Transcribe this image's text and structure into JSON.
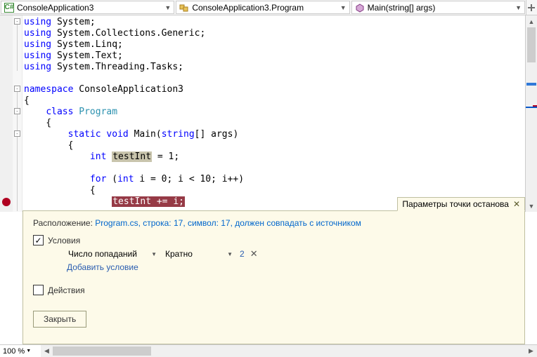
{
  "nav": {
    "project": "ConsoleApplication3",
    "class": "ConsoleApplication3.Program",
    "method": "Main(string[] args)"
  },
  "code": {
    "lines": [
      {
        "indent": "",
        "tokens": [
          {
            "t": "using ",
            "c": "kw"
          },
          {
            "t": "System;",
            "c": ""
          }
        ]
      },
      {
        "indent": "",
        "tokens": [
          {
            "t": "using ",
            "c": "kw"
          },
          {
            "t": "System.Collections.Generic;",
            "c": ""
          }
        ]
      },
      {
        "indent": "",
        "tokens": [
          {
            "t": "using ",
            "c": "kw"
          },
          {
            "t": "System.Linq;",
            "c": ""
          }
        ]
      },
      {
        "indent": "",
        "tokens": [
          {
            "t": "using ",
            "c": "kw"
          },
          {
            "t": "System.Text;",
            "c": ""
          }
        ]
      },
      {
        "indent": "",
        "tokens": [
          {
            "t": "using ",
            "c": "kw"
          },
          {
            "t": "System.Threading.Tasks;",
            "c": ""
          }
        ]
      },
      {
        "indent": "",
        "tokens": []
      },
      {
        "indent": "",
        "tokens": [
          {
            "t": "namespace ",
            "c": "kw"
          },
          {
            "t": "ConsoleApplication3",
            "c": ""
          }
        ]
      },
      {
        "indent": "",
        "tokens": [
          {
            "t": "{",
            "c": ""
          }
        ]
      },
      {
        "indent": "    ",
        "tokens": [
          {
            "t": "class ",
            "c": "kw"
          },
          {
            "t": "Program",
            "c": "type"
          }
        ]
      },
      {
        "indent": "    ",
        "tokens": [
          {
            "t": "{",
            "c": ""
          }
        ]
      },
      {
        "indent": "        ",
        "tokens": [
          {
            "t": "static ",
            "c": "kw"
          },
          {
            "t": "void ",
            "c": "kw"
          },
          {
            "t": "Main(",
            "c": ""
          },
          {
            "t": "string",
            "c": "kw"
          },
          {
            "t": "[] args)",
            "c": ""
          }
        ]
      },
      {
        "indent": "        ",
        "tokens": [
          {
            "t": "{",
            "c": ""
          }
        ]
      },
      {
        "indent": "            ",
        "tokens": [
          {
            "t": "int ",
            "c": "kw"
          },
          {
            "t": "testInt",
            "c": "hl"
          },
          {
            "t": " = 1;",
            "c": ""
          }
        ]
      },
      {
        "indent": "",
        "tokens": []
      },
      {
        "indent": "            ",
        "tokens": [
          {
            "t": "for ",
            "c": "kw"
          },
          {
            "t": "(",
            "c": ""
          },
          {
            "t": "int ",
            "c": "kw"
          },
          {
            "t": "i = 0; i < 10; i++)",
            "c": ""
          }
        ]
      },
      {
        "indent": "            ",
        "tokens": [
          {
            "t": "{",
            "c": ""
          }
        ]
      },
      {
        "indent": "                ",
        "tokens": [
          {
            "t": "testInt += i;",
            "c": "bp"
          }
        ]
      }
    ],
    "breakpoint_line_index": 16
  },
  "panel": {
    "title": "Параметры точки останова",
    "location_label": "Расположение: ",
    "location_link": "Program.cs, строка: 17, символ: 17, должен совпадать с источником",
    "conditions_label": "Условия",
    "conditions_checked": true,
    "hit_count_label": "Число попаданий",
    "hit_count_mode": "Кратно",
    "hit_count_value": "2",
    "add_condition": "Добавить условие",
    "actions_label": "Действия",
    "actions_checked": false,
    "close": "Закрыть"
  },
  "zoom": "100 %"
}
